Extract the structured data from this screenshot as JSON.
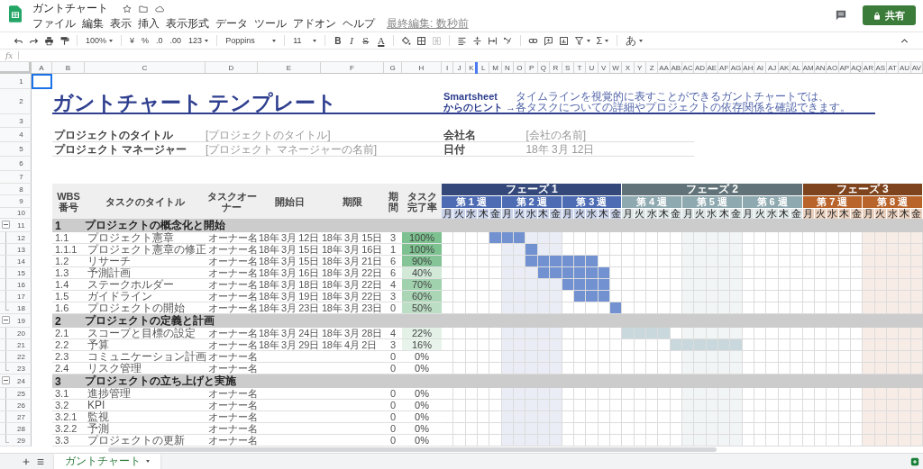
{
  "app": {
    "title": "ガントチャート",
    "menus": [
      "ファイル",
      "編集",
      "表示",
      "挿入",
      "表示形式",
      "データ",
      "ツール",
      "アドオン",
      "ヘルプ"
    ],
    "last_edit": "最終編集: 数秒前",
    "share": "共有"
  },
  "toolbar": {
    "zoom": "100%",
    "currency": "¥",
    "percent": "%",
    "decrease_decimal": ".0",
    "increase_decimal": ".00",
    "number_format": "123",
    "font": "Poppins",
    "font_size": "11",
    "bold": "B",
    "italic": "I",
    "strikethrough": "S",
    "text_color": "A",
    "merge": {
      "disabled": true
    },
    "functions": "Σ",
    "input_tool": "あ"
  },
  "formula_bar": {
    "label": "fx"
  },
  "column_headers": [
    "A",
    "B",
    "C",
    "D",
    "E",
    "F",
    "G",
    "H",
    "I",
    "J",
    "K",
    "L",
    "M",
    "N",
    "O",
    "P",
    "Q",
    "R",
    "S",
    "T",
    "U",
    "V",
    "W",
    "X",
    "Y",
    "Z",
    "AA",
    "AB",
    "AC",
    "AD",
    "AE",
    "AF",
    "AG",
    "AH",
    "AI",
    "AJ",
    "AK",
    "AL",
    "AM",
    "AN",
    "AO",
    "AP",
    "AQ",
    "AR",
    "AS",
    "AT",
    "AU",
    "AV"
  ],
  "row_numbers": [
    "1",
    "2",
    "3",
    "4",
    "5",
    "6",
    "7",
    "8",
    "9",
    "10",
    "11",
    "12",
    "13",
    "14",
    "15",
    "16",
    "17",
    "18",
    "19",
    "20",
    "21",
    "22",
    "23",
    "24",
    "25",
    "26",
    "27",
    "28",
    "29"
  ],
  "sheet": {
    "title": "ガントチャート テンプレート",
    "hint_heading": [
      "Smartsheet",
      "からのヒント →"
    ],
    "hint_text": [
      "タイムラインを視覚的に表すことができるガントチャートでは、",
      "各タスクについての詳細やプロジェクトの依存関係を確認できます。"
    ],
    "info_left": [
      {
        "label": "プロジェクトのタイトル",
        "value": "[プロジェクトのタイトル]"
      },
      {
        "label": "プロジェクト マネージャー",
        "value": "[プロジェクト マネージャーの名前]"
      }
    ],
    "info_right": [
      {
        "label": "会社名",
        "value": "[会社の名前]"
      },
      {
        "label": "日付",
        "value": "18年 3月 12日"
      }
    ],
    "headers": [
      "WBS 番号",
      "タスクのタイトル",
      "タスクオーナー",
      "開始日",
      "期限",
      "期間",
      "タスク完了率"
    ],
    "phases": [
      {
        "label": "フェーズ 1",
        "color": "#4d6cb4",
        "weeks": [
          {
            "label": "第 1 週",
            "shaded": false,
            "days": [
              "月",
              "火",
              "水",
              "木",
              "金"
            ]
          },
          {
            "label": "第 2 週",
            "shaded": true,
            "days": [
              "月",
              "火",
              "水",
              "木",
              "金"
            ]
          },
          {
            "label": "第 3 週",
            "shaded": false,
            "days": [
              "月",
              "火",
              "水",
              "木",
              "金"
            ]
          }
        ]
      },
      {
        "label": "フェーズ 2",
        "color": "#8fa9b0",
        "weeks": [
          {
            "label": "第 4 週",
            "shaded": false,
            "days": [
              "月",
              "火",
              "水",
              "木",
              "金"
            ]
          },
          {
            "label": "第 5 週",
            "shaded": true,
            "days": [
              "月",
              "火",
              "水",
              "木",
              "金"
            ]
          },
          {
            "label": "第 6 週",
            "shaded": false,
            "days": [
              "月",
              "火",
              "水",
              "木",
              "金"
            ]
          }
        ]
      },
      {
        "label": "フェーズ 3",
        "color": "#b9642b",
        "weeks": [
          {
            "label": "第 7 週",
            "shaded": false,
            "days": [
              "月",
              "火",
              "水",
              "木",
              "金"
            ]
          },
          {
            "label": "第 8 週",
            "shaded": true,
            "days": [
              "月",
              "火",
              "水",
              "木",
              "金"
            ]
          }
        ]
      }
    ],
    "groups": [
      {
        "number": "1",
        "title": "プロジェクトの概念化と開始",
        "color": "#7191d1",
        "tasks": [
          {
            "wbs": "1.1",
            "title": "プロジェクト憲章",
            "owner": "オーナー名",
            "start": "18年 3月 12日",
            "end": "18年 3月 15日",
            "duration": "3",
            "completion": "100%",
            "color": "#7cc18f",
            "bar": [
              false,
              false,
              false,
              false,
              true,
              true,
              true,
              false,
              false,
              false,
              false,
              false,
              false,
              false,
              false,
              false,
              false,
              false,
              false,
              false,
              false,
              false,
              false,
              false,
              false,
              false,
              false,
              false,
              false,
              false,
              false,
              false,
              false,
              false,
              false,
              false,
              false,
              false,
              false,
              false
            ]
          },
          {
            "wbs": "1.1.1",
            "title": "プロジェクト憲章の修正",
            "owner": "オーナー名",
            "start": "18年 3月 15日",
            "end": "18年 3月 16日",
            "duration": "1",
            "completion": "100%",
            "color": "#7cc18f",
            "bar": [
              false,
              false,
              false,
              false,
              false,
              false,
              false,
              true,
              false,
              false,
              false,
              false,
              false,
              false,
              false,
              false,
              false,
              false,
              false,
              false,
              false,
              false,
              false,
              false,
              false,
              false,
              false,
              false,
              false,
              false,
              false,
              false,
              false,
              false,
              false,
              false,
              false,
              false,
              false,
              false
            ]
          },
          {
            "wbs": "1.2",
            "title": "リサーチ",
            "owner": "オーナー名",
            "start": "18年 3月 15日",
            "end": "18年 3月 21日",
            "duration": "6",
            "completion": "90%",
            "color": "#84c496",
            "bar": [
              false,
              false,
              false,
              false,
              false,
              false,
              false,
              true,
              true,
              true,
              true,
              true,
              true,
              false,
              false,
              false,
              false,
              false,
              false,
              false,
              false,
              false,
              false,
              false,
              false,
              false,
              false,
              false,
              false,
              false,
              false,
              false,
              false,
              false,
              false,
              false,
              false,
              false,
              false,
              false
            ]
          },
          {
            "wbs": "1.3",
            "title": "予測計画",
            "owner": "オーナー名",
            "start": "18年 3月 16日",
            "end": "18年 3月 22日",
            "duration": "6",
            "completion": "40%",
            "color": "#d2e9d8",
            "bar": [
              false,
              false,
              false,
              false,
              false,
              false,
              false,
              false,
              true,
              true,
              true,
              true,
              true,
              true,
              false,
              false,
              false,
              false,
              false,
              false,
              false,
              false,
              false,
              false,
              false,
              false,
              false,
              false,
              false,
              false,
              false,
              false,
              false,
              false,
              false,
              false,
              false,
              false,
              false,
              false
            ]
          },
          {
            "wbs": "1.4",
            "title": "ステークホルダー",
            "owner": "オーナー名",
            "start": "18年 3月 18日",
            "end": "18年 3月 22日",
            "duration": "4",
            "completion": "70%",
            "color": "#a1d2ae",
            "bar": [
              false,
              false,
              false,
              false,
              false,
              false,
              false,
              false,
              false,
              false,
              true,
              true,
              true,
              true,
              false,
              false,
              false,
              false,
              false,
              false,
              false,
              false,
              false,
              false,
              false,
              false,
              false,
              false,
              false,
              false,
              false,
              false,
              false,
              false,
              false,
              false,
              false,
              false,
              false,
              false
            ]
          },
          {
            "wbs": "1.5",
            "title": "ガイドライン",
            "owner": "オーナー名",
            "start": "18年 3月 19日",
            "end": "18年 3月 22日",
            "duration": "3",
            "completion": "60%",
            "color": "#aad6b6",
            "bar": [
              false,
              false,
              false,
              false,
              false,
              false,
              false,
              false,
              false,
              false,
              false,
              true,
              true,
              true,
              false,
              false,
              false,
              false,
              false,
              false,
              false,
              false,
              false,
              false,
              false,
              false,
              false,
              false,
              false,
              false,
              false,
              false,
              false,
              false,
              false,
              false,
              false,
              false,
              false,
              false
            ]
          },
          {
            "wbs": "1.6",
            "title": "プロジェクトの開始",
            "owner": "オーナー名",
            "start": "18年 3月 23日",
            "end": "18年 3月 23日",
            "duration": "0",
            "completion": "50%",
            "color": "#bcdec5",
            "bar": [
              false,
              false,
              false,
              false,
              false,
              false,
              false,
              false,
              false,
              false,
              false,
              false,
              false,
              false,
              true,
              false,
              false,
              false,
              false,
              false,
              false,
              false,
              false,
              false,
              false,
              false,
              false,
              false,
              false,
              false,
              false,
              false,
              false,
              false,
              false,
              false,
              false,
              false,
              false,
              false
            ]
          }
        ]
      },
      {
        "number": "2",
        "title": "プロジェクトの定義と計画",
        "color": "#c8d8dc",
        "tasks": [
          {
            "wbs": "2.1",
            "title": "スコープと目標の設定",
            "owner": "オーナー名",
            "start": "18年 3月 24日",
            "end": "18年 3月 28日",
            "duration": "4",
            "completion": "22%",
            "color": "#e3f1e7",
            "bar": [
              false,
              false,
              false,
              false,
              false,
              false,
              false,
              false,
              false,
              false,
              false,
              false,
              false,
              false,
              false,
              true,
              true,
              true,
              true,
              false,
              false,
              false,
              false,
              false,
              false,
              false,
              false,
              false,
              false,
              false,
              false,
              false,
              false,
              false,
              false,
              false,
              false,
              false,
              false,
              false
            ]
          },
          {
            "wbs": "2.2",
            "title": "予算",
            "owner": "オーナー名",
            "start": "18年 3月 29日",
            "end": "18年 4月 2日",
            "duration": "3",
            "completion": "16%",
            "color": "#e8f4eb",
            "bar": [
              false,
              false,
              false,
              false,
              false,
              false,
              false,
              false,
              false,
              false,
              false,
              false,
              false,
              false,
              false,
              false,
              false,
              false,
              false,
              true,
              true,
              true,
              true,
              true,
              true,
              false,
              false,
              false,
              false,
              false,
              false,
              false,
              false,
              false,
              false,
              false,
              false,
              false,
              false,
              false
            ]
          },
          {
            "wbs": "2.3",
            "title": "コミュニケーション計画",
            "owner": "オーナー名",
            "duration": "0",
            "completion": "0%",
            "color": "#ffffff"
          },
          {
            "wbs": "2.4",
            "title": "リスク管理",
            "owner": "オーナー名",
            "duration": "0",
            "completion": "0%",
            "color": "#ffffff"
          }
        ]
      },
      {
        "number": "3",
        "title": "プロジェクトの立ち上げと実施",
        "tasks": [
          {
            "wbs": "3.1",
            "title": "進捗管理",
            "owner": "オーナー名",
            "duration": "0",
            "completion": "0%",
            "color": "#ffffff"
          },
          {
            "wbs": "3.2",
            "title": "KPI",
            "owner": "オーナー名",
            "duration": "0",
            "completion": "0%",
            "color": "#ffffff"
          },
          {
            "wbs": "3.2.1",
            "title": "監視",
            "owner": "オーナー名",
            "duration": "0",
            "completion": "0%",
            "color": "#ffffff"
          },
          {
            "wbs": "3.2.2",
            "title": "予測",
            "owner": "オーナー名",
            "duration": "0",
            "completion": "0%",
            "color": "#ffffff"
          },
          {
            "wbs": "3.3",
            "title": "プロジェクトの更新",
            "owner": "オーナー名",
            "duration": "0",
            "completion": "0%",
            "color": "#ffffff"
          }
        ]
      }
    ]
  },
  "sheet_tabs": [
    {
      "label": "ガントチャート",
      "selected": true
    }
  ]
}
